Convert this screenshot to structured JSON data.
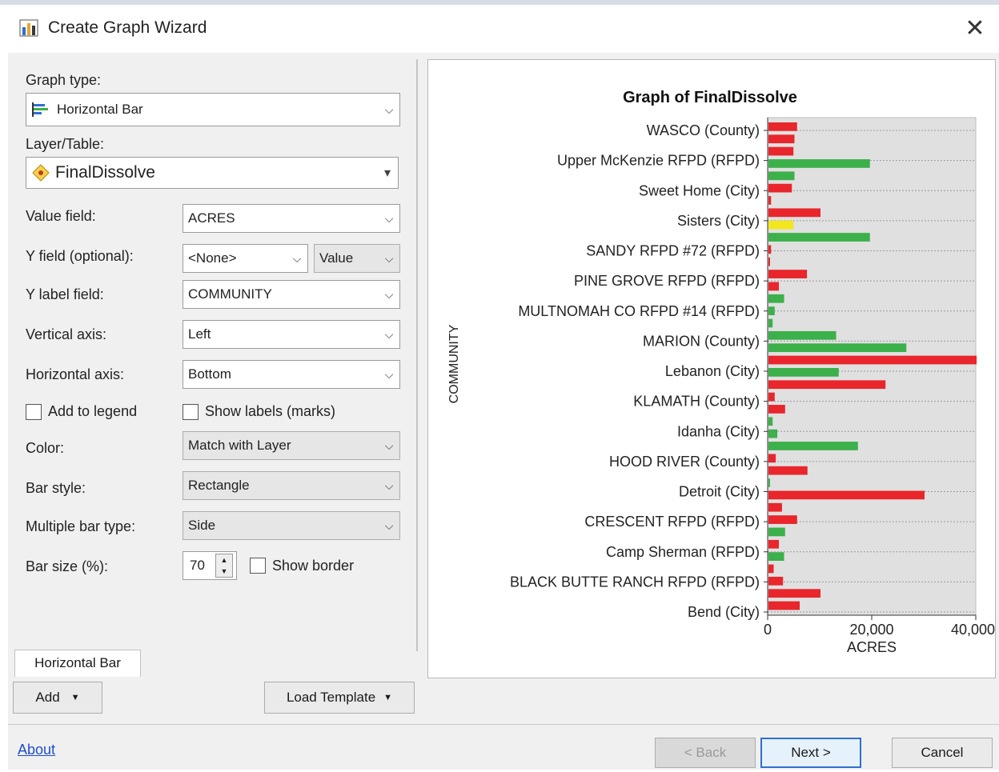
{
  "window": {
    "title": "Create Graph Wizard",
    "close_glyph": "✕",
    "icon_name": "graph-wizard-icon"
  },
  "form": {
    "graph_type": {
      "label": "Graph type:",
      "value": "Horizontal Bar"
    },
    "layer_table": {
      "label": "Layer/Table:",
      "value": "FinalDissolve"
    },
    "value_field": {
      "label": "Value field:",
      "value": "ACRES"
    },
    "y_field": {
      "label": "Y field (optional):",
      "value": "<None>",
      "secondary": "Value"
    },
    "y_label_field": {
      "label": "Y label field:",
      "value": "COMMUNITY"
    },
    "vertical_axis": {
      "label": "Vertical axis:",
      "value": "Left"
    },
    "horizontal_axis": {
      "label": "Horizontal axis:",
      "value": "Bottom"
    },
    "add_to_legend": {
      "label": "Add to legend",
      "checked": false
    },
    "show_labels": {
      "label": "Show labels (marks)",
      "checked": false
    },
    "color": {
      "label": "Color:",
      "value": "Match with Layer"
    },
    "bar_style": {
      "label": "Bar style:",
      "value": "Rectangle"
    },
    "multiple_bar_type": {
      "label": "Multiple bar type:",
      "value": "Side"
    },
    "bar_size": {
      "label": "Bar size (%):",
      "value": "70"
    },
    "show_border": {
      "label": "Show border",
      "checked": false
    }
  },
  "tabs": [
    "Horizontal Bar"
  ],
  "buttons": {
    "add": "Add",
    "load_template": "Load Template",
    "back": "< Back",
    "next": "Next >",
    "cancel": "Cancel",
    "about": "About"
  },
  "colors": {
    "red": "#e8262c",
    "green": "#3cb04a",
    "yellow": "#f2e61c",
    "plot_bg": "#e0e0e0"
  },
  "chart_data": {
    "type": "bar",
    "orientation": "horizontal",
    "title": "Graph of FinalDissolve",
    "xlabel": "ACRES",
    "ylabel": "COMMUNITY",
    "xlim": [
      0,
      40000
    ],
    "xticks": [
      "0",
      "20,000",
      "40,000"
    ],
    "labeled_categories": [
      "WASCO (County)",
      "Upper McKenzie RFPD (RFPD)",
      "Sweet Home (City)",
      "Sisters (City)",
      "SANDY RFPD #72 (RFPD)",
      "PINE GROVE RFPD (RFPD)",
      "MULTNOMAH CO RFPD #14 (RFPD)",
      "MARION (County)",
      "Lebanon (City)",
      "KLAMATH (County)",
      "Idanha (City)",
      "HOOD RIVER (County)",
      "Detroit (City)",
      "CRESCENT RFPD (RFPD)",
      "Camp Sherman (RFPD)",
      "BLACK BUTTE RANCH RFPD (RFPD)",
      "Bend (City)"
    ],
    "bars": [
      {
        "value": 5500,
        "color": "red"
      },
      {
        "value": 5000,
        "color": "red"
      },
      {
        "value": 4800,
        "color": "red"
      },
      {
        "value": 19500,
        "color": "green"
      },
      {
        "value": 5000,
        "color": "green"
      },
      {
        "value": 4500,
        "color": "red"
      },
      {
        "value": 500,
        "color": "red"
      },
      {
        "value": 10000,
        "color": "red"
      },
      {
        "value": 4800,
        "color": "yellow"
      },
      {
        "value": 19500,
        "color": "green"
      },
      {
        "value": 500,
        "color": "red"
      },
      {
        "value": 300,
        "color": "red"
      },
      {
        "value": 7400,
        "color": "red"
      },
      {
        "value": 2000,
        "color": "red"
      },
      {
        "value": 3000,
        "color": "green"
      },
      {
        "value": 1200,
        "color": "green"
      },
      {
        "value": 800,
        "color": "green"
      },
      {
        "value": 13000,
        "color": "green"
      },
      {
        "value": 26500,
        "color": "green"
      },
      {
        "value": 40000,
        "color": "red"
      },
      {
        "value": 13500,
        "color": "green"
      },
      {
        "value": 22500,
        "color": "red"
      },
      {
        "value": 1200,
        "color": "red"
      },
      {
        "value": 3200,
        "color": "red"
      },
      {
        "value": 800,
        "color": "green"
      },
      {
        "value": 1700,
        "color": "green"
      },
      {
        "value": 17200,
        "color": "green"
      },
      {
        "value": 1400,
        "color": "red"
      },
      {
        "value": 7500,
        "color": "red"
      },
      {
        "value": 300,
        "color": "green"
      },
      {
        "value": 30000,
        "color": "red"
      },
      {
        "value": 2600,
        "color": "red"
      },
      {
        "value": 5500,
        "color": "red"
      },
      {
        "value": 3200,
        "color": "green"
      },
      {
        "value": 2000,
        "color": "red"
      },
      {
        "value": 3000,
        "color": "green"
      },
      {
        "value": 1000,
        "color": "red"
      },
      {
        "value": 2800,
        "color": "red"
      },
      {
        "value": 10000,
        "color": "red"
      },
      {
        "value": 6000,
        "color": "red"
      }
    ],
    "grid": true
  }
}
